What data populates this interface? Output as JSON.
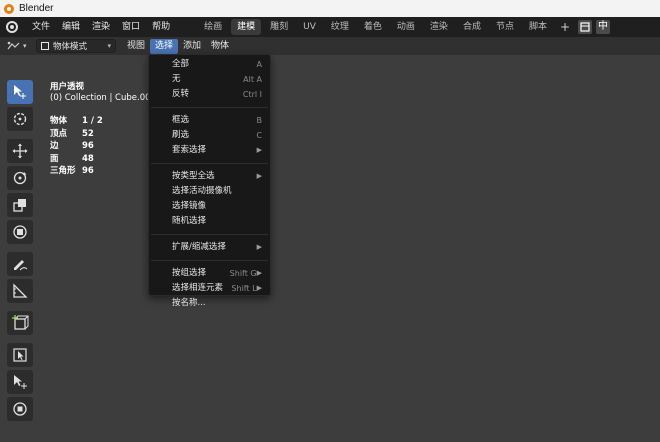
{
  "window": {
    "title": "Blender"
  },
  "menubar": {
    "items": [
      {
        "name": "menu-file",
        "label": "文件"
      },
      {
        "name": "menu-edit",
        "label": "编辑"
      },
      {
        "name": "menu-render",
        "label": "渲染"
      },
      {
        "name": "menu-window",
        "label": "窗口"
      },
      {
        "name": "menu-help",
        "label": "帮助"
      }
    ],
    "workspaces": [
      {
        "label": "绘画"
      },
      {
        "label": "建模"
      },
      {
        "label": "雕刻"
      },
      {
        "label": "UV"
      },
      {
        "label": "纹理"
      },
      {
        "label": "着色"
      },
      {
        "label": "动画"
      },
      {
        "label": "渲染"
      },
      {
        "label": "合成"
      },
      {
        "label": "节点"
      },
      {
        "label": "脚本"
      }
    ],
    "active_workspace": "建模",
    "add_label": "+",
    "lang_label": "中"
  },
  "viewport_header": {
    "mode": "物体模式",
    "menus": [
      {
        "label": "视图"
      },
      {
        "label": "选择"
      },
      {
        "label": "添加"
      },
      {
        "label": "物体"
      }
    ],
    "active_menu": "选择"
  },
  "overlay": {
    "view_name": "用户透视",
    "collection": "(0) Collection | Cube.001",
    "stats": [
      {
        "key": "物体",
        "value": "1 / 2"
      },
      {
        "key": "顶点",
        "value": "52"
      },
      {
        "key": "边",
        "value": "96"
      },
      {
        "key": "面",
        "value": "48"
      },
      {
        "key": "三角形",
        "value": "96"
      }
    ]
  },
  "select_menu": {
    "groups": [
      [
        {
          "label": "全部",
          "shortcut": "A"
        },
        {
          "label": "无",
          "shortcut": "Alt A"
        },
        {
          "label": "反转",
          "shortcut": "Ctrl I"
        }
      ],
      [
        {
          "label": "框选",
          "shortcut": "B"
        },
        {
          "label": "刷选",
          "shortcut": "C"
        },
        {
          "label": "套索选择",
          "submenu": true
        }
      ],
      [
        {
          "label": "按类型全选",
          "submenu": true
        },
        {
          "label": "选择活动摄像机"
        },
        {
          "label": "选择镜像"
        },
        {
          "label": "随机选择"
        }
      ],
      [
        {
          "label": "扩展/缩减选择",
          "submenu": true
        }
      ],
      [
        {
          "label": "按组选择",
          "shortcut": "Shift G",
          "submenu": true
        },
        {
          "label": "选择相连元素",
          "shortcut": "Shift L",
          "submenu": true
        },
        {
          "label": "按名称..."
        }
      ]
    ]
  },
  "colors": {
    "accent": "#4772b3",
    "viewport_bg": "#3d3d3d",
    "menu_bg": "#181818",
    "topbar_bg": "#1f1f1f"
  }
}
